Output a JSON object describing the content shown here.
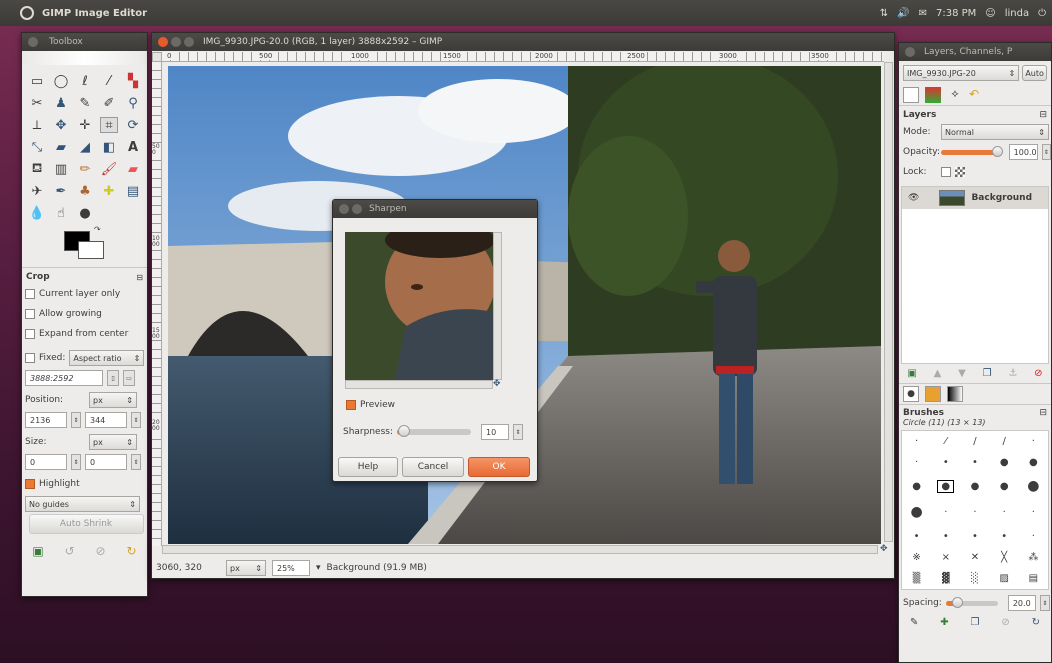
{
  "topbar": {
    "app_name": "GIMP Image Editor",
    "time": "7:38 PM",
    "user": "linda"
  },
  "toolbox": {
    "title": "Toolbox",
    "tool_options_title": "Crop",
    "options": {
      "current_layer_only": "Current layer only",
      "allow_growing": "Allow growing",
      "expand_from_center": "Expand from center",
      "fixed_label": "Fixed:",
      "fixed_value": "Aspect ratio",
      "ratio_value": "3888:2592",
      "position_label": "Position:",
      "position_unit": "px",
      "position_x": "2136",
      "position_y": "344",
      "size_label": "Size:",
      "size_unit": "px",
      "size_w": "0",
      "size_h": "0",
      "highlight_label": "Highlight",
      "guides_value": "No guides",
      "auto_shrink": "Auto Shrink"
    },
    "colors": {
      "fg": "#000000",
      "bg": "#ffffff"
    }
  },
  "image_window": {
    "title": "IMG_9930.JPG-20.0 (RGB, 1 layer) 3888x2592 – GIMP",
    "ruler_labels": [
      "0",
      "500",
      "1000",
      "1500",
      "2000",
      "2500",
      "3000",
      "3500"
    ],
    "ruler_v_labels": [
      "500",
      "1000",
      "1500",
      "2000"
    ],
    "status": {
      "coords": "3060, 320",
      "unit": "px",
      "zoom": "25%",
      "info": "Background (91.9 MB)"
    }
  },
  "sharpen": {
    "title": "Sharpen",
    "preview_label": "Preview",
    "sharpness_label": "Sharpness:",
    "sharpness_value": "10",
    "sharpness_level_pct": 10,
    "help": "Help",
    "cancel": "Cancel",
    "ok": "OK"
  },
  "layers_panel": {
    "title": "Layers, Channels, P",
    "image_selector": "IMG_9930.JPG-20",
    "auto_btn": "Auto",
    "section": "Layers",
    "mode_label": "Mode:",
    "mode_value": "Normal",
    "opacity_label": "Opacity:",
    "opacity_value": "100.0",
    "lock_label": "Lock:",
    "layer_name": "Background",
    "brushes_title": "Brushes",
    "brush_name": "Circle (11) (13 × 13)",
    "spacing_label": "Spacing:",
    "spacing_value": "20.0"
  },
  "accent": "#e97a35"
}
